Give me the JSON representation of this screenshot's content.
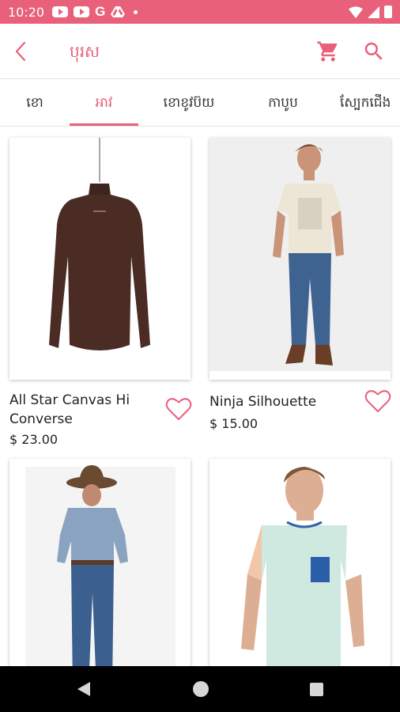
{
  "status_bar": {
    "time": "10:20",
    "icons": [
      "youtube-icon",
      "youtube-icon",
      "google-icon",
      "drive-icon",
      "notification-dot-icon",
      "wifi-icon",
      "signal-icon",
      "battery-icon"
    ],
    "google_glyph": "G"
  },
  "app_bar": {
    "title": "បុរស",
    "icons": [
      "back-arrow-icon",
      "cart-icon",
      "search-icon"
    ]
  },
  "tabs": [
    {
      "label": "ខោ",
      "active": false
    },
    {
      "label": "អាវ",
      "active": true
    },
    {
      "label": "ខោខូវប៊យ",
      "active": false
    },
    {
      "label": "កាបូប",
      "active": false
    },
    {
      "label": "ស្បែកជើង",
      "active": false
    }
  ],
  "products": [
    {
      "name": "All Star Canvas Hi Converse",
      "price": "$ 23.00",
      "image": "brown-turtleneck-on-hanger",
      "favorite_icon": "heart-outline-icon"
    },
    {
      "name": "Ninja Silhouette",
      "price": "$ 15.00",
      "image": "man-white-tshirt-jeans",
      "favorite_icon": "heart-outline-icon"
    },
    {
      "name": "",
      "price": "",
      "image": "cowboy-plaid-shirt-jeans"
    },
    {
      "name": "",
      "price": "",
      "image": "man-mint-tshirt-pocket"
    }
  ],
  "colors": {
    "accent": "#e8607a",
    "status_bar": "#e8607a",
    "nav_bar": "#000000"
  },
  "nav_bar": {
    "icons": [
      "nav-back-icon",
      "nav-home-icon",
      "nav-recents-icon"
    ]
  }
}
